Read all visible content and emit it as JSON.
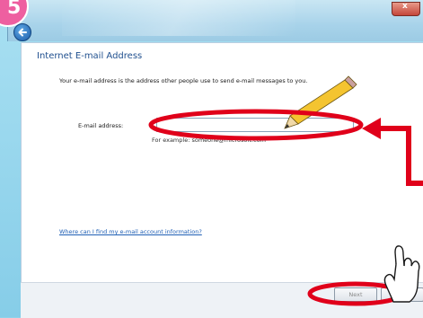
{
  "step_badge": "5",
  "window": {
    "close_label": "x"
  },
  "wizard": {
    "heading": "Internet E-mail Address",
    "intro": "Your e-mail address is the address other people use to send e-mail messages to you.",
    "email_label": "E-mail address:",
    "email_value": "",
    "example": "For example: someone@microsoft.com",
    "help_link": "Where can I find my e-mail account information?"
  },
  "footer": {
    "next_label": "Next",
    "cancel_label": "cel"
  },
  "colors": {
    "annotation_red": "#e0001a",
    "heading_blue": "#1f4f8e",
    "link_blue": "#1f5fb5",
    "badge_pink": "#ee5fa0"
  },
  "icons": [
    "back-arrow-icon",
    "pencil-icon",
    "pointing-hand-icon",
    "callout-arrow-icon"
  ]
}
